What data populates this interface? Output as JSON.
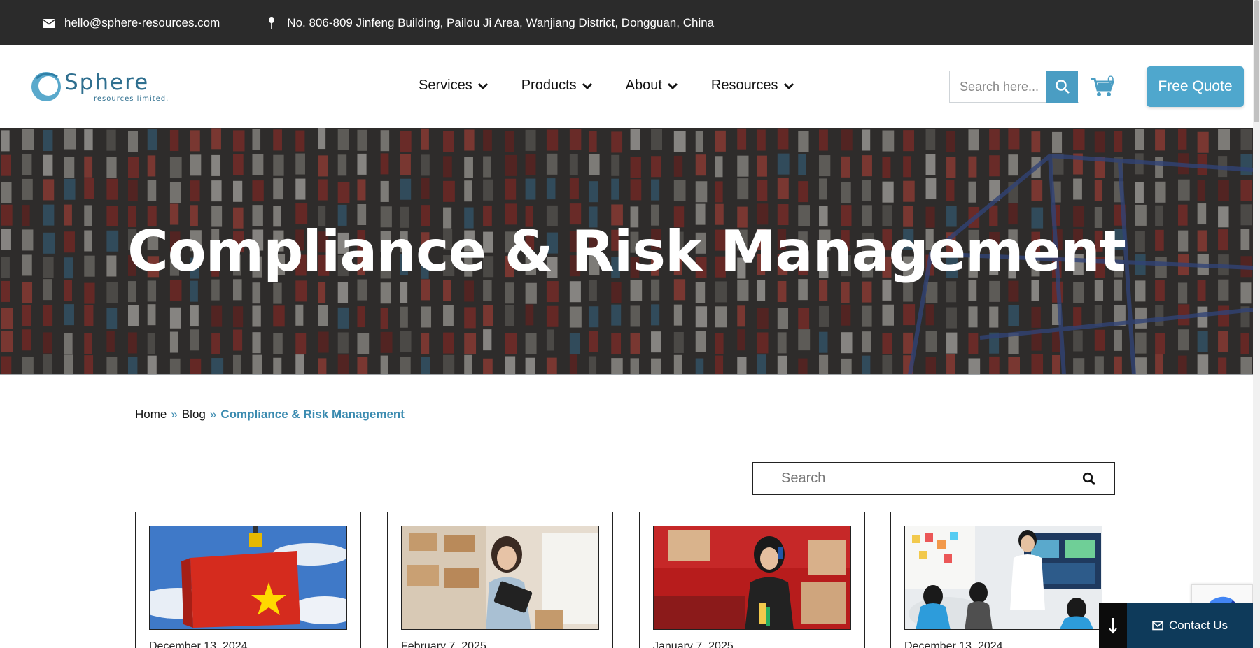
{
  "topbar": {
    "email": "hello@sphere-resources.com",
    "address": "No. 806-809 Jinfeng Building, Pailou Ji Area, Wanjiang District, Dongguan, China",
    "email_icon": "envelope-icon",
    "address_icon": "map-pin-icon"
  },
  "header": {
    "logo_text": "Sphere",
    "logo_subtext": "resources limited.",
    "nav": [
      {
        "label": "Services"
      },
      {
        "label": "Products"
      },
      {
        "label": "About"
      },
      {
        "label": "Resources"
      }
    ],
    "search_placeholder": "Search here...",
    "cart_count": "0",
    "quote_label": "Free Quote"
  },
  "hero": {
    "title": "Compliance & Risk Management"
  },
  "breadcrumb": {
    "home": "Home",
    "blog": "Blog",
    "separator": "»",
    "current": "Compliance & Risk Management"
  },
  "blog_search": {
    "placeholder": "Search"
  },
  "cards": [
    {
      "date": "December 13, 2024",
      "image": "vietnam-flag-container"
    },
    {
      "date": "February 7, 2025",
      "image": "woman-with-tablet-warehouse"
    },
    {
      "date": "January 7, 2025",
      "image": "woman-on-phone-boxes"
    },
    {
      "date": "December 13, 2024",
      "image": "team-meeting-office"
    }
  ],
  "floating": {
    "contact_label": "Contact Us",
    "scroll_icon": "arrow-down-icon"
  },
  "colors": {
    "accent": "#4fa7cd",
    "topbar_bg": "#2b2b2b",
    "contact_bg": "#0e3a5a",
    "breadcrumb_link": "#3b8bb0"
  }
}
